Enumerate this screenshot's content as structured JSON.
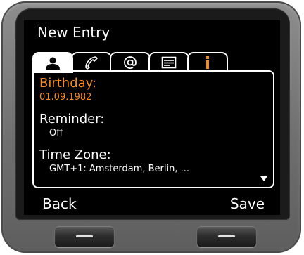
{
  "screen": {
    "title": "New Entry",
    "tabs": [
      {
        "icon": "person-icon",
        "active": true
      },
      {
        "icon": "phone-handset-icon",
        "active": false
      },
      {
        "icon": "at-icon",
        "active": false
      },
      {
        "icon": "contact-card-icon",
        "active": false
      },
      {
        "icon": "info-icon",
        "active": false
      }
    ],
    "fields": {
      "birthday": {
        "label": "Birthday:",
        "value": "01.09.1982"
      },
      "reminder": {
        "label": "Reminder:",
        "value": "Off"
      },
      "timezone": {
        "label": "Time Zone:",
        "value": "GMT+1: Amsterdam, Berlin, ..."
      }
    },
    "softkeys": {
      "left": "Back",
      "right": "Save"
    }
  },
  "colors": {
    "accent": "#f08c30",
    "screen_bg": "#000000",
    "text": "#ffffff"
  }
}
